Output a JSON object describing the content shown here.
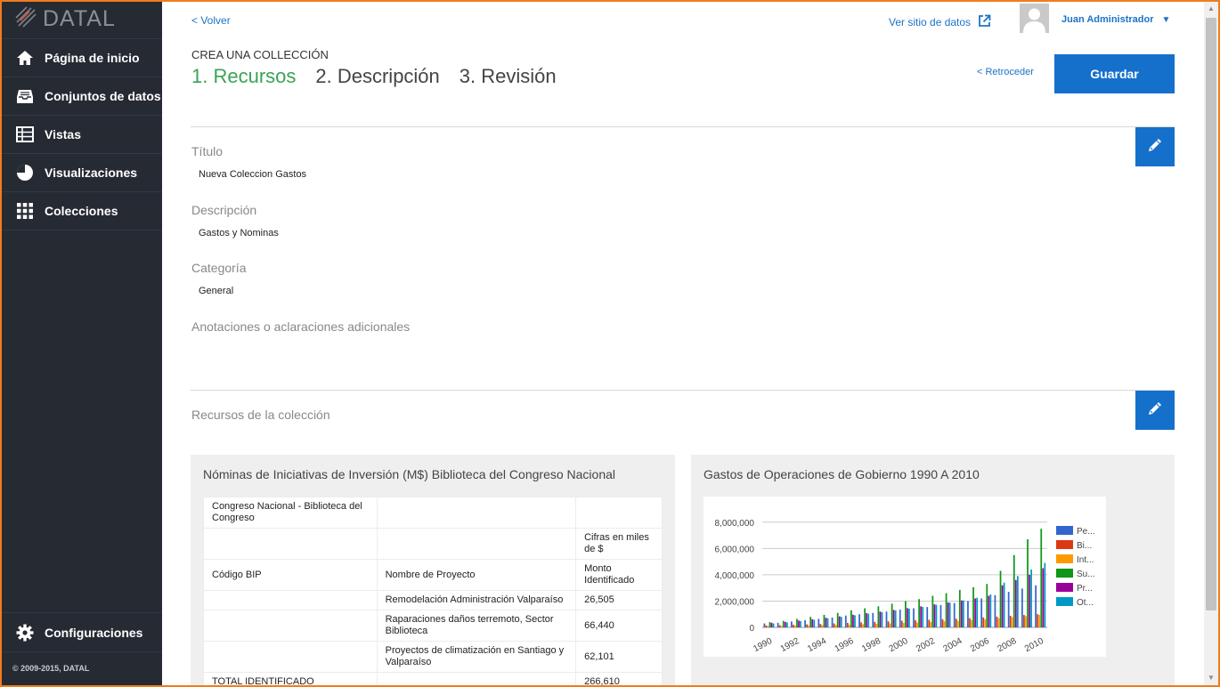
{
  "sidebar": {
    "brand": "DATAL",
    "items": [
      {
        "label": "Página de inicio",
        "icon": "home-icon"
      },
      {
        "label": "Conjuntos de datos",
        "icon": "inbox-icon"
      },
      {
        "label": "Vistas",
        "icon": "table-icon"
      },
      {
        "label": "Visualizaciones",
        "icon": "pie-chart-icon"
      },
      {
        "label": "Colecciones",
        "icon": "grid-icon"
      }
    ],
    "config_label": "Configuraciones",
    "copyright": "© 2009-2015, DATAL"
  },
  "header": {
    "back_label": "< Volver",
    "site_label": "Ver sitio de datos",
    "user_name": "Juan Administrador",
    "caret": "▼"
  },
  "wizard": {
    "heading": "CREA UNA COLLECCIÓN",
    "steps": [
      "1. Recursos",
      "2. Descripción",
      "3. Revisión"
    ],
    "back_label": "< Retroceder",
    "save_label": "Guardar"
  },
  "fields": {
    "title_label": "Título",
    "title_value": "Nueva Coleccion Gastos",
    "desc_label": "Descripción",
    "desc_value": "Gastos y Nominas",
    "cat_label": "Categoría",
    "cat_value": "General",
    "notes_label": "Anotaciones o aclaraciones adicionales"
  },
  "resources": {
    "section_label": "Recursos de la colección",
    "table_panel": {
      "title": "Nóminas de Iniciativas de Inversión (M$) Biblioteca del Congreso Nacional",
      "rows": [
        [
          "Congreso Nacional - Biblioteca del Congreso",
          "",
          ""
        ],
        [
          "",
          "",
          "Cifras en miles de $"
        ],
        [
          "Código BIP",
          "Nombre de Proyecto",
          "Monto Identificado"
        ],
        [
          "",
          "Remodelación Administración Valparaíso",
          "26,505"
        ],
        [
          "",
          "Raparaciones daños terremoto, Sector Biblioteca",
          "66,440"
        ],
        [
          "",
          "Proyectos de climatización en Santiago y Valparaíso",
          "62,101"
        ],
        [
          "TOTAL IDENTIFICADO",
          "",
          "266,610"
        ]
      ]
    },
    "chart_panel": {
      "title": "Gastos de Operaciones de Gobierno 1990 A 2010"
    }
  },
  "chart_data": {
    "type": "bar",
    "title": "",
    "xlabel": "",
    "ylabel": "",
    "ylim": [
      0,
      9000000
    ],
    "yticks": [
      "0",
      "2,000,000",
      "4,000,000",
      "6,000,000",
      "8,000,000"
    ],
    "ytick_values": [
      0,
      2000000,
      4000000,
      6000000,
      8000000
    ],
    "xtick_labels": [
      "1990",
      "1992",
      "1994",
      "1996",
      "1998",
      "2000",
      "2002",
      "2004",
      "2006",
      "2008",
      "2010"
    ],
    "categories": [
      "1990",
      "1991",
      "1992",
      "1993",
      "1994",
      "1995",
      "1996",
      "1997",
      "1998",
      "1999",
      "2000",
      "2001",
      "2002",
      "2003",
      "2004",
      "2005",
      "2006",
      "2007",
      "2008",
      "2009",
      "2010"
    ],
    "legend_position": "right",
    "series": [
      {
        "name": "Pe...",
        "color": "#3366cc",
        "values": [
          300000,
          350000,
          450000,
          550000,
          650000,
          750000,
          900000,
          1000000,
          1100000,
          1200000,
          1350000,
          1450000,
          1550000,
          1700000,
          1850000,
          2000000,
          2200000,
          2450000,
          2700000,
          2950000,
          3200000
        ]
      },
      {
        "name": "Bi...",
        "color": "#dc3912",
        "values": [
          150000,
          170000,
          200000,
          230000,
          260000,
          300000,
          340000,
          380000,
          420000,
          460000,
          500000,
          540000,
          580000,
          620000,
          660000,
          700000,
          760000,
          820000,
          880000,
          940000,
          1000000
        ]
      },
      {
        "name": "Int...",
        "color": "#ff9900",
        "values": [
          100000,
          110000,
          130000,
          150000,
          170000,
          190000,
          210000,
          240000,
          270000,
          300000,
          340000,
          380000,
          420000,
          460000,
          500000,
          560000,
          620000,
          700000,
          780000,
          860000,
          950000
        ]
      },
      {
        "name": "Su...",
        "color": "#109618",
        "values": [
          400000,
          500000,
          650000,
          800000,
          950000,
          1100000,
          1300000,
          1450000,
          1600000,
          1800000,
          2000000,
          2150000,
          2400000,
          2600000,
          2850000,
          3050000,
          3300000,
          4300000,
          5500000,
          6700000,
          7500000
        ]
      },
      {
        "name": "Pr...",
        "color": "#990099",
        "values": [
          350000,
          420000,
          520000,
          620000,
          730000,
          840000,
          960000,
          1080000,
          1200000,
          1330000,
          1470000,
          1600000,
          1750000,
          1900000,
          2050000,
          2200000,
          2400000,
          3200000,
          3600000,
          4000000,
          4500000
        ]
      },
      {
        "name": "Ot...",
        "color": "#0099c6",
        "values": [
          300000,
          380000,
          480000,
          580000,
          690000,
          800000,
          920000,
          1040000,
          1160000,
          1290000,
          1420000,
          1560000,
          1720000,
          1880000,
          2050000,
          2250000,
          2500000,
          3400000,
          3900000,
          4400000,
          4900000
        ]
      }
    ]
  }
}
